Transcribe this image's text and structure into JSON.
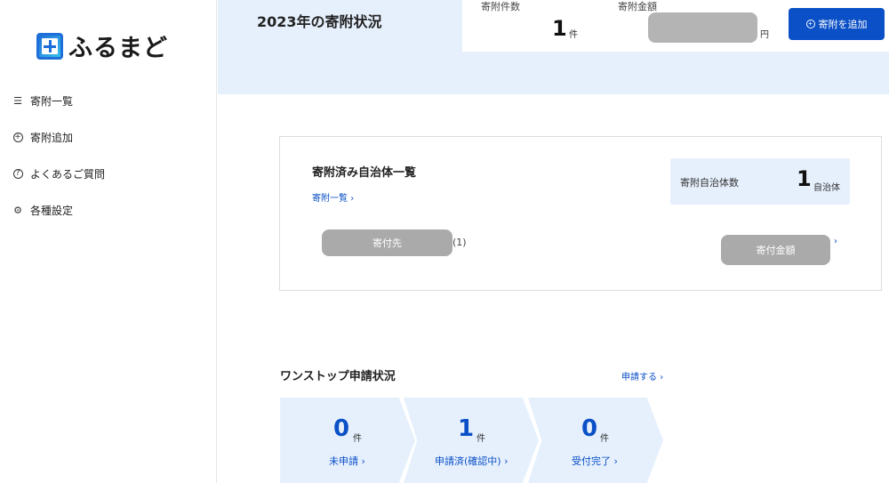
{
  "sidebar": {
    "logo_text": "ふるまど",
    "items": [
      {
        "label": "寄附一覧",
        "icon": "list-icon"
      },
      {
        "label": "寄附追加",
        "icon": "plus-circle-icon"
      },
      {
        "label": "よくあるご質問",
        "icon": "question-circle-icon"
      },
      {
        "label": "各種設定",
        "icon": "gear-icon"
      }
    ]
  },
  "header": {
    "title": "2023年の寄附状況",
    "count_label": "寄附件数",
    "count_value": "1",
    "count_unit": "件",
    "amount_label": "寄附金額",
    "amount_unit": "円",
    "add_button": "寄附を追加"
  },
  "municipality": {
    "title": "寄附済み自治体一覧",
    "link": "寄附一覧",
    "count_label": "寄附自治体数",
    "count_value": "1",
    "count_unit": "自治体",
    "destination_label": "寄付先",
    "destination_count": "(1)",
    "amount_label": "寄付金額"
  },
  "onestop": {
    "title": "ワンストップ申請状況",
    "link": "申請する",
    "steps": [
      {
        "value": "0",
        "unit": "件",
        "label": "未申請"
      },
      {
        "value": "1",
        "unit": "件",
        "label": "申請済(確認中)"
      },
      {
        "value": "0",
        "unit": "件",
        "label": "受付完了"
      }
    ]
  },
  "colors": {
    "accent": "#0b50c6",
    "light_blue": "#e6f0fd",
    "mask_gray": "#aaaaaa"
  }
}
